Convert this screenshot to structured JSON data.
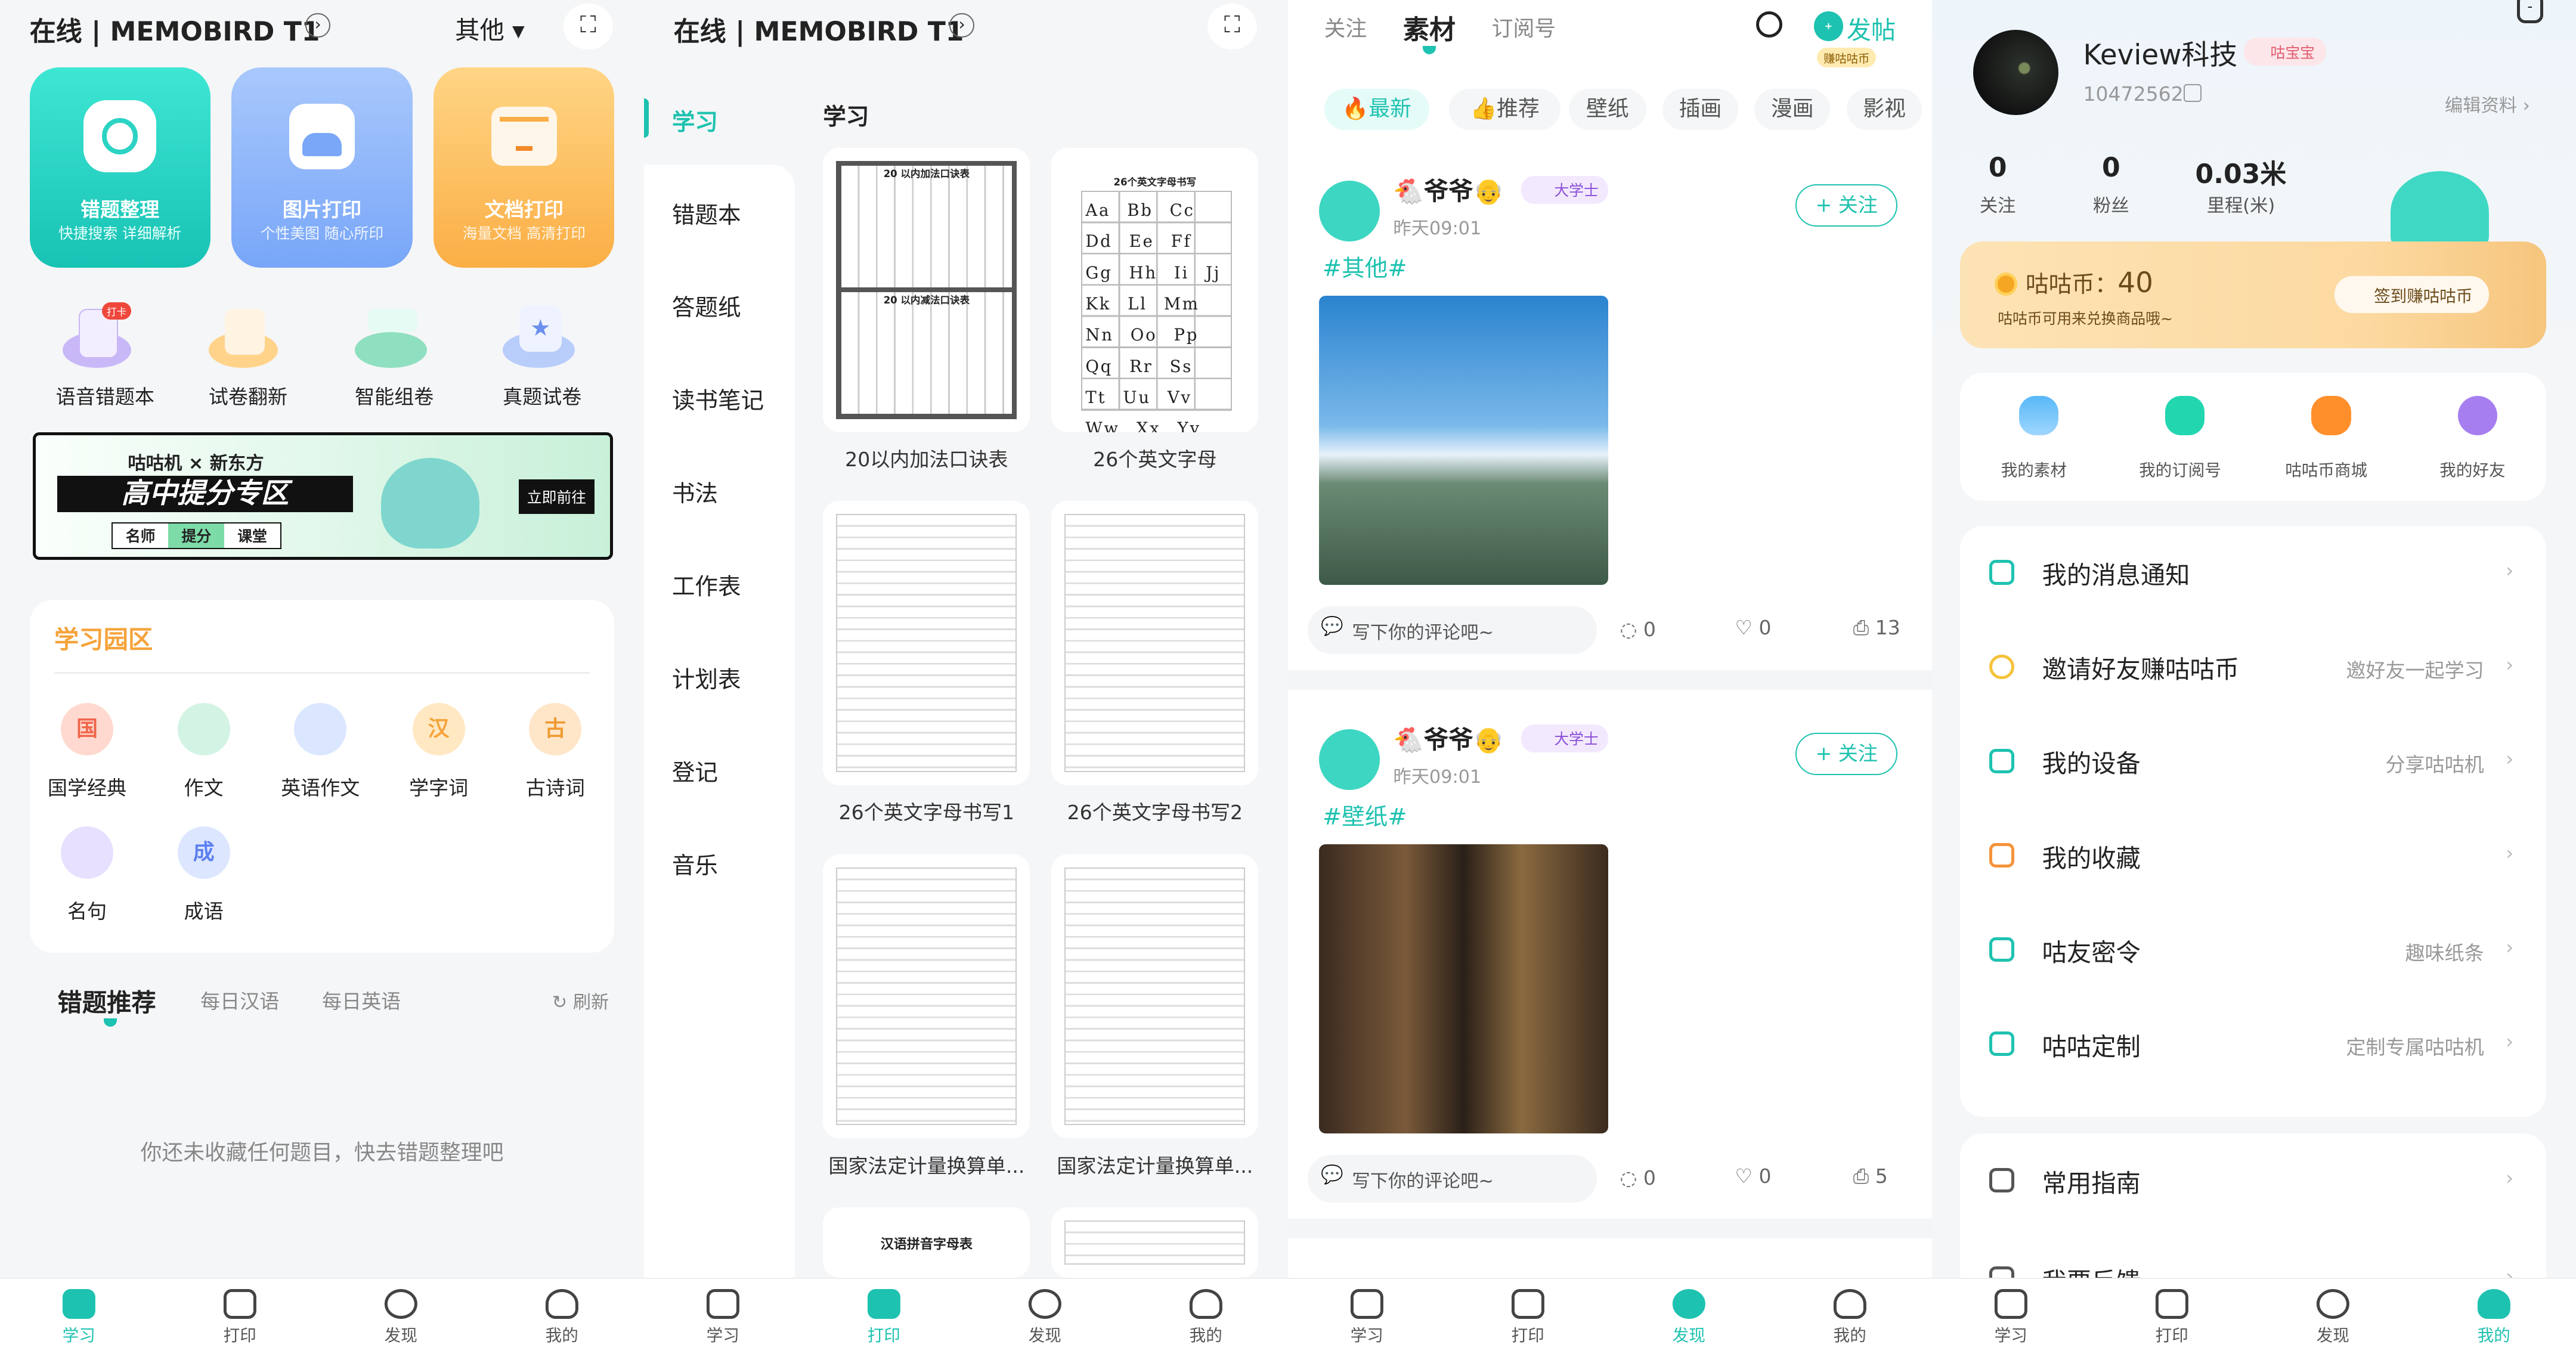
{
  "colors": {
    "accent": "#1ec2b0",
    "orange": "#f7a93c",
    "blue": "#7aa7f7"
  },
  "nav": {
    "study": "学习",
    "print": "打印",
    "discover": "发现",
    "mine": "我的"
  },
  "home": {
    "status": "在线 | MEMOBIRD T1",
    "other": "其他",
    "cards": [
      {
        "title": "错题整理",
        "sub": "快捷搜索 详细解析"
      },
      {
        "title": "图片打印",
        "sub": "个性美图 随心所印"
      },
      {
        "title": "文档打印",
        "sub": "海量文档 高清打印"
      }
    ],
    "tools": [
      {
        "label": "语音错题本",
        "badge": "打卡"
      },
      {
        "label": "试卷翻新"
      },
      {
        "label": "智能组卷"
      },
      {
        "label": "真题试卷"
      }
    ],
    "banner": {
      "top": "咕咕机 × 新东方",
      "title": "高中提分专区",
      "tags": [
        "名师",
        "提分",
        "课堂"
      ],
      "cta": "立即前往"
    },
    "garden": {
      "title": "学习园区",
      "items": [
        "国学经典",
        "作文",
        "英语作文",
        "学字词",
        "古诗词",
        "名句",
        "成语"
      ],
      "icons": [
        "国",
        "",
        "",
        "汉",
        "古",
        "",
        "成"
      ]
    },
    "tabs": [
      "错题推荐",
      "每日汉语",
      "每日英语"
    ],
    "refresh": "刷新",
    "empty": "你还未收藏任何题目，快去错题整理吧"
  },
  "print": {
    "status": "在线 | MEMOBIRD T1",
    "sidebar": [
      "学习",
      "错题本",
      "答题纸",
      "读书笔记",
      "书法",
      "工作表",
      "计划表",
      "登记",
      "音乐"
    ],
    "section": "学习",
    "items": [
      "20以内加法口诀表",
      "26个英文字母",
      "26个英文字母书写1",
      "26个英文字母书写2",
      "国家法定计量换算单...",
      "国家法定计量换算单..."
    ],
    "thumb_titles": [
      "20 以内加法口诀表",
      "20 以内减法口诀表",
      "26个英文字母书写",
      "汉语拼音字母表"
    ]
  },
  "discover": {
    "tabs": [
      "关注",
      "素材",
      "订阅号"
    ],
    "post": "发帖",
    "earn": "赚咕咕币",
    "chips": [
      "最新",
      "推荐",
      "壁纸",
      "插画",
      "漫画",
      "影视"
    ],
    "posts": [
      {
        "user": "🐔爷爷👴",
        "badge": "大学士",
        "time": "昨天09:01",
        "follow": "+ 关注",
        "tag": "#其他#",
        "comment": "写下你的评论吧~",
        "comments": "0",
        "likes": "0",
        "prints": "13"
      },
      {
        "user": "🐔爷爷👴",
        "badge": "大学士",
        "time": "昨天09:01",
        "follow": "+ 关注",
        "tag": "#壁纸#",
        "comment": "写下你的评论吧~",
        "comments": "0",
        "likes": "0",
        "prints": "5"
      }
    ]
  },
  "me": {
    "name": "Keview科技",
    "level": "咕宝宝",
    "id": "10472562",
    "edit": "编辑资料 ›",
    "stats": [
      {
        "value": "0",
        "label": "关注"
      },
      {
        "value": "0",
        "label": "粉丝"
      },
      {
        "value": "0.03米",
        "label": "里程(米)"
      }
    ],
    "coins": {
      "label": "咕咕币：",
      "value": "40",
      "hint": "咕咕币可用来兑换商品哦~",
      "button": "签到赚咕咕币"
    },
    "quick": [
      "我的素材",
      "我的订阅号",
      "咕咕币商城",
      "我的好友"
    ],
    "list": [
      {
        "name": "我的消息通知",
        "sub": ""
      },
      {
        "name": "邀请好友赚咕咕币",
        "sub": "邀好友一起学习"
      },
      {
        "name": "我的设备",
        "sub": "分享咕咕机"
      },
      {
        "name": "我的收藏",
        "sub": ""
      },
      {
        "name": "咕友密令",
        "sub": "趣味纸条"
      },
      {
        "name": "咕咕定制",
        "sub": "定制专属咕咕机"
      }
    ],
    "list2": [
      "常用指南",
      "我要反馈"
    ]
  }
}
